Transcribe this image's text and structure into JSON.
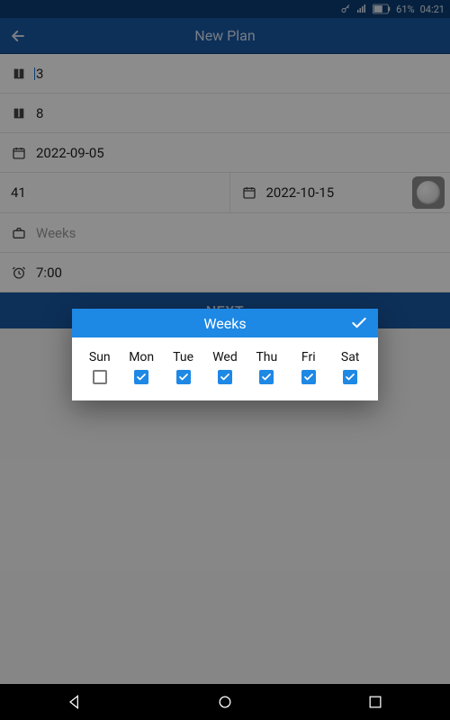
{
  "status": {
    "battery": "61%",
    "time": "04:21"
  },
  "header": {
    "title": "New Plan"
  },
  "form": {
    "field1": "3",
    "field2": "8",
    "start_date": "2022-09-05",
    "count": "41",
    "end_date": "2022-10-15",
    "weeks_label": "Weeks",
    "time": "7:00"
  },
  "next_label": "NEXT",
  "dialog": {
    "title": "Weeks",
    "days": [
      {
        "label": "Sun",
        "checked": false
      },
      {
        "label": "Mon",
        "checked": true
      },
      {
        "label": "Tue",
        "checked": true
      },
      {
        "label": "Wed",
        "checked": true
      },
      {
        "label": "Thu",
        "checked": true
      },
      {
        "label": "Fri",
        "checked": true
      },
      {
        "label": "Sat",
        "checked": true
      }
    ]
  }
}
